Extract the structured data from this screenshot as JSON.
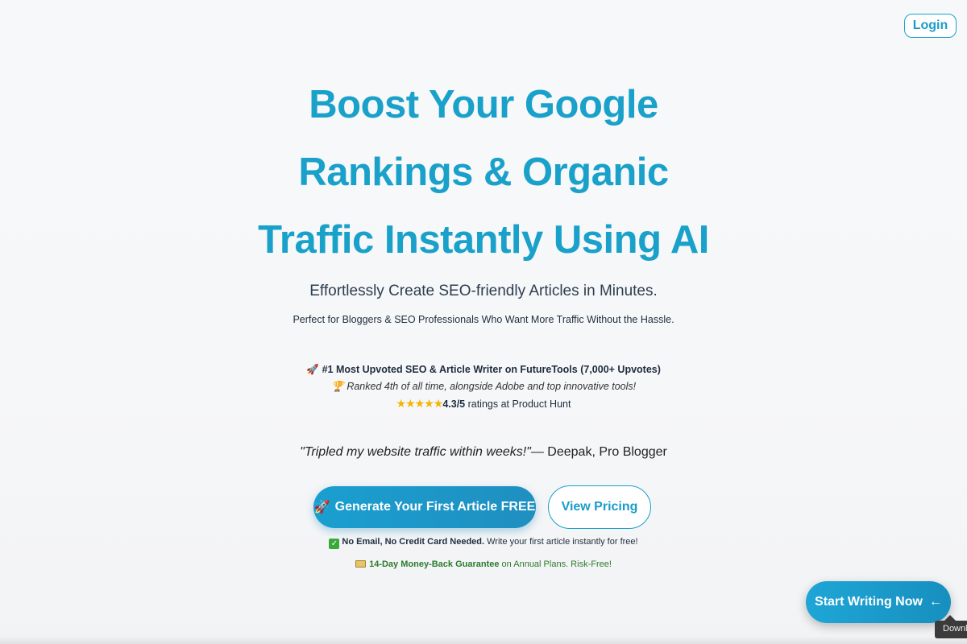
{
  "header": {
    "login_label": "Login"
  },
  "hero": {
    "title_lines": [
      "Boost Your Google",
      "Rankings & Organic",
      "Traffic Instantly Using AI"
    ],
    "subtitle": "Effortlessly Create SEO-friendly Articles in Minutes.",
    "subtitle2": "Perfect for Bloggers & SEO Professionals Who Want More Traffic Without the Hassle."
  },
  "proof": {
    "line1_icon": "🚀",
    "line1": "#1 Most Upvoted SEO & Article Writer on FutureTools (7,000+ Upvotes)",
    "line2_icon": "🏆",
    "line2": "Ranked 4th of all time, alongside Adobe and top innovative tools!",
    "stars": "★★★★★",
    "rating": "4.3/5",
    "rating_suffix": " ratings at Product Hunt"
  },
  "quote": {
    "text": "\"Tripled my website traffic within weeks!\"",
    "author": "— Deepak, Pro Blogger"
  },
  "cta": {
    "primary_icon": "🚀",
    "primary_label": "Generate Your First Article FREE",
    "secondary_label": "View Pricing"
  },
  "notes": {
    "note1_bold": "No Email, No Credit Card Needed.",
    "note1_rest": " Write your first article instantly for free!",
    "note2_bold": "14-Day Money-Back Guarantee",
    "note2_rest": " on Annual Plans. Risk-Free!"
  },
  "floating": {
    "label": "Start Writing Now",
    "arrow": "←"
  },
  "tooltip": {
    "text": "Download"
  },
  "colors": {
    "accent": "#1aa1ca",
    "guarantee_green": "#2d7a2d"
  }
}
